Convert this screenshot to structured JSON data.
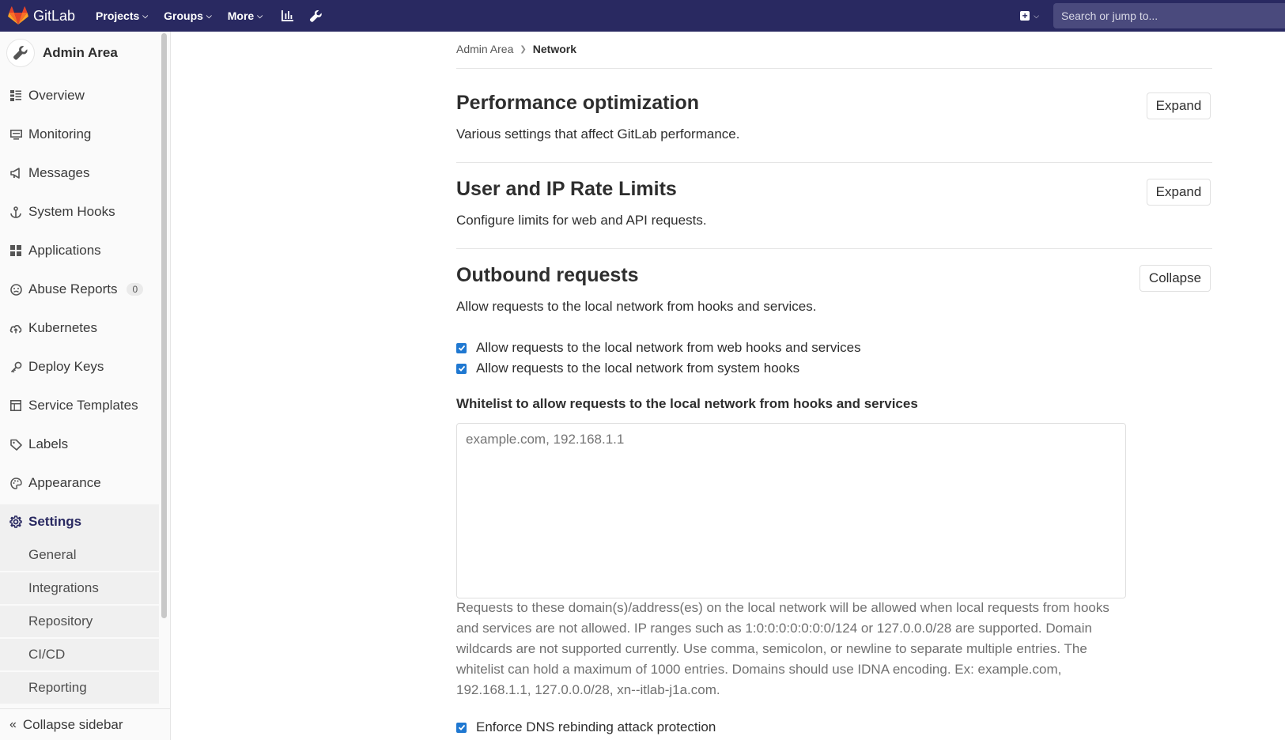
{
  "navbar": {
    "brand": "GitLab",
    "items": [
      {
        "label": "Projects"
      },
      {
        "label": "Groups"
      },
      {
        "label": "More"
      }
    ],
    "icons": [
      "activity-chart-icon",
      "admin-wrench-icon"
    ],
    "search_placeholder": "Search or jump to..."
  },
  "sidebar": {
    "title": "Admin Area",
    "items": [
      {
        "label": "Overview",
        "icon": "overview-icon"
      },
      {
        "label": "Monitoring",
        "icon": "monitor-icon"
      },
      {
        "label": "Messages",
        "icon": "megaphone-icon"
      },
      {
        "label": "System Hooks",
        "icon": "anchor-icon"
      },
      {
        "label": "Applications",
        "icon": "apps-grid-icon"
      },
      {
        "label": "Abuse Reports",
        "icon": "smiley-icon",
        "badge": "0"
      },
      {
        "label": "Kubernetes",
        "icon": "cloud-icon"
      },
      {
        "label": "Deploy Keys",
        "icon": "key-icon"
      },
      {
        "label": "Service Templates",
        "icon": "template-icon"
      },
      {
        "label": "Labels",
        "icon": "label-icon"
      },
      {
        "label": "Appearance",
        "icon": "palette-icon"
      },
      {
        "label": "Settings",
        "icon": "gear-icon",
        "active": true
      }
    ],
    "sub_items": [
      {
        "label": "General"
      },
      {
        "label": "Integrations"
      },
      {
        "label": "Repository"
      },
      {
        "label": "CI/CD"
      },
      {
        "label": "Reporting"
      }
    ],
    "collapse_label": "Collapse sidebar"
  },
  "breadcrumb": {
    "parent": "Admin Area",
    "current": "Network"
  },
  "sections": [
    {
      "title": "Performance optimization",
      "description": "Various settings that affect GitLab performance.",
      "button": "Expand"
    },
    {
      "title": "User and IP Rate Limits",
      "description": "Configure limits for web and API requests.",
      "button": "Expand"
    },
    {
      "title": "Outbound requests",
      "description": "Allow requests to the local network from hooks and services.",
      "button": "Collapse"
    }
  ],
  "outbound": {
    "checkboxes": [
      {
        "label": "Allow requests to the local network from web hooks and services",
        "checked": true
      },
      {
        "label": "Allow requests to the local network from system hooks",
        "checked": true
      }
    ],
    "whitelist_label": "Whitelist to allow requests to the local network from hooks and services",
    "whitelist_placeholder": "example.com, 192.168.1.1",
    "whitelist_value": "",
    "help_text": "Requests to these domain(s)/address(es) on the local network will be allowed when local requests from hooks and services are not allowed. IP ranges such as 1:0:0:0:0:0:0:0/124 or 127.0.0.0/28 are supported. Domain wildcards are not supported currently. Use comma, semicolon, or newline to separate multiple entries. The whitelist can hold a maximum of 1000 entries. Domains should use IDNA encoding. Ex: example.com, 192.168.1.1, 127.0.0.0/28, xn--itlab-j1a.com.",
    "dns_checkbox": {
      "label": "Enforce DNS rebinding attack protection",
      "checked": true
    }
  },
  "colors": {
    "navbar_bg": "#292961",
    "active_text": "#292961",
    "checkbox": "#1f78d1",
    "logo_orange": "#e24329"
  }
}
